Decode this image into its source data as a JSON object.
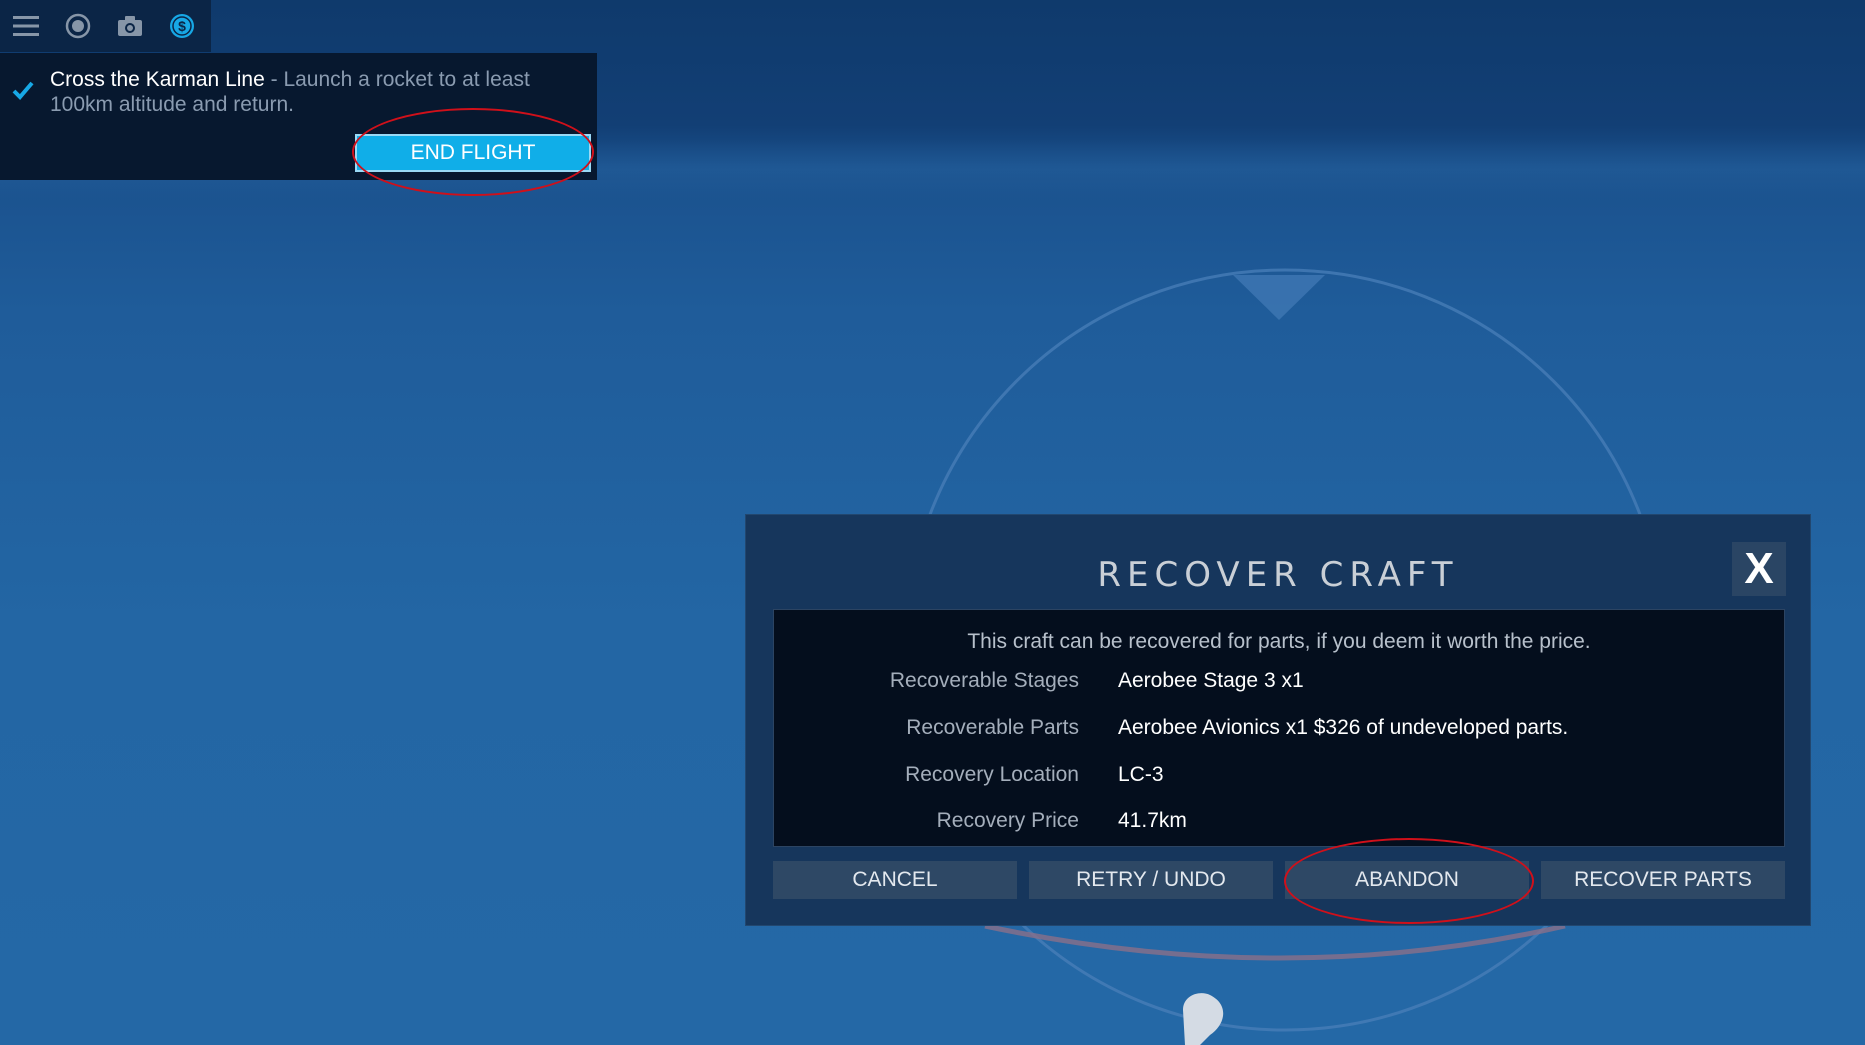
{
  "toolbar": {
    "icons": [
      "menu-icon",
      "camera-view-icon",
      "camera-icon",
      "currency-icon"
    ],
    "active_color": "#17a8e6"
  },
  "objective": {
    "title": "Cross the Karman Line",
    "separator": " - ",
    "description": "Launch a rocket to at least 100km altitude and return.",
    "completed": true,
    "end_flight_label": "END FLIGHT"
  },
  "dialog": {
    "title": "RECOVER CRAFT",
    "close_label": "X",
    "intro": "This craft can be recovered for parts, if you deem it worth the price.",
    "rows": [
      {
        "label": "Recoverable Stages",
        "value": "Aerobee Stage 3 x1"
      },
      {
        "label": "Recoverable Parts",
        "value": "Aerobee Avionics x1 $326 of undeveloped parts."
      },
      {
        "label": "Recovery Location",
        "value": "LC-3"
      },
      {
        "label": "Recovery Price",
        "value": "41.7km"
      }
    ],
    "buttons": {
      "cancel": "CANCEL",
      "retry": "RETRY / UNDO",
      "abandon": "ABANDON",
      "recover": "RECOVER PARTS"
    }
  },
  "colors": {
    "accent": "#10aee8",
    "annotation_ring": "#d0101a"
  }
}
